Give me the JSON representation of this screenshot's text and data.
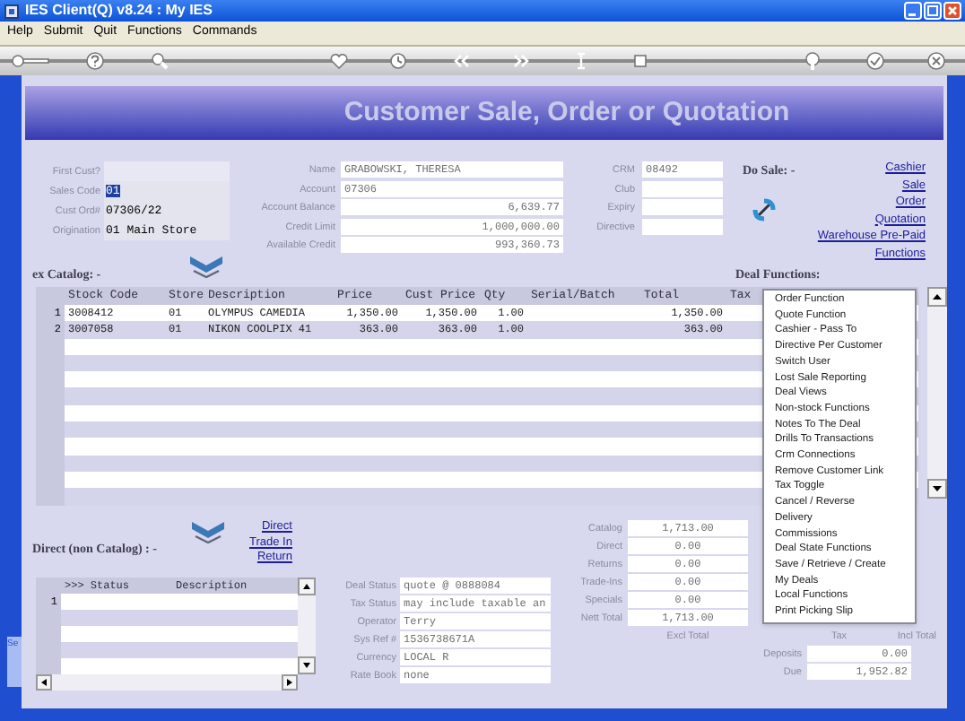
{
  "window": {
    "title": "IES Client(Q) v8.24 : My IES"
  },
  "menu": [
    "Help",
    "Submit",
    "Quit",
    "Functions",
    "Commands"
  ],
  "banner": "Customer Sale, Order or Quotation",
  "customer_fields": [
    {
      "label": "First Cust?"
    },
    {
      "label": "Sales Code",
      "value": "01",
      "highlighted": true
    },
    {
      "label": "Cust Ord#",
      "value": "07306/22",
      "highlighted": false
    },
    {
      "label": "Origination",
      "value": "01 Main Store",
      "highlighted": false
    }
  ],
  "account_fields": [
    {
      "label": "Name",
      "value": "GRABOWSKI, THERESA",
      "kind": "text"
    },
    {
      "label": "Account",
      "value": "07306",
      "kind": "text"
    },
    {
      "label": "Account Balance",
      "value": "6,639.77",
      "kind": "amount"
    },
    {
      "label": "Credit Limit",
      "value": "1,000,000.00",
      "kind": "amount"
    },
    {
      "label": "Available Credit",
      "value": "993,360.73",
      "kind": "amount"
    }
  ],
  "crm_fields": [
    {
      "label": "CRM",
      "value": "08492"
    },
    {
      "label": "Club"
    },
    {
      "label": "Expiry"
    },
    {
      "label": "Directive"
    }
  ],
  "do_sale": {
    "label": "Do Sale: -",
    "links": [
      "Cashier",
      "Sale",
      "Order",
      "Quotation",
      "Warehouse Pre-Paid",
      "Functions"
    ]
  },
  "deal_functions_label": "Deal Functions:",
  "catalog": {
    "label": "ex Catalog: -",
    "columns": [
      "Stock Code",
      "Store",
      "Description",
      "Price",
      "Cust Price",
      "Qty",
      "Serial/Batch",
      "Total",
      "Tax"
    ],
    "rows": [
      {
        "number": "1",
        "stock_code": "3008412",
        "store": "01",
        "description": "OLYMPUS CAMEDIA",
        "price": "1,350.00",
        "cust_price": "1,350.00",
        "qty": "1.00",
        "total": "1,350.00"
      },
      {
        "number": "2",
        "stock_code": "3007058",
        "store": "01",
        "description": "NIKON COOLPIX 41",
        "price": "363.00",
        "cust_price": "363.00",
        "qty": "1.00",
        "total": "363.00"
      }
    ]
  },
  "functions_menu": [
    "Order Function",
    "Quote Function",
    "Cashier - Pass To",
    "Directive Per Customer",
    "Switch User",
    "Lost Sale Reporting",
    "Deal Views",
    "Non-stock Functions",
    "Notes To The Deal",
    "Drills To Transactions",
    "Crm Connections",
    "Remove Customer Link",
    "Tax Toggle",
    "Cancel / Reverse",
    "Delivery",
    "Commissions",
    "Deal State Functions",
    "Save / Retrieve / Create",
    "My Deals",
    "Local Functions",
    "Print Picking Slip"
  ],
  "direct": {
    "label": "Direct (non Catalog) : -",
    "links": [
      "Direct",
      "Trade In",
      "Return"
    ],
    "columns": [
      ">>> Status",
      "Description"
    ],
    "rows": [
      {
        "number": "1"
      }
    ]
  },
  "deal_fields": [
    {
      "label": "Deal Status",
      "value": "quote @ 0888084"
    },
    {
      "label": "Tax Status",
      "value": "may include taxable an"
    },
    {
      "label": "Operator",
      "value": "Terry"
    },
    {
      "label": "Sys Ref #",
      "value": "1536738671A"
    },
    {
      "label": "Currency",
      "value": "LOCAL R"
    },
    {
      "label": "Rate Book",
      "value": "none"
    }
  ],
  "totals": [
    {
      "label": "Catalog",
      "value": "1,713.00"
    },
    {
      "label": "Direct",
      "value": "0.00"
    },
    {
      "label": "Returns",
      "value": "0.00"
    },
    {
      "label": "Trade-Ins",
      "value": "0.00"
    },
    {
      "label": "Specials",
      "value": "0.00"
    },
    {
      "label": "Nett Total",
      "value": "1,713.00"
    }
  ],
  "total_headings": [
    "Excl Total",
    "Tax",
    "Incl Total"
  ],
  "payments": [
    {
      "label": "Deposits",
      "value": "0.00"
    },
    {
      "label": "Due",
      "value": "1,952.82"
    }
  ],
  "side_tab": "Se"
}
